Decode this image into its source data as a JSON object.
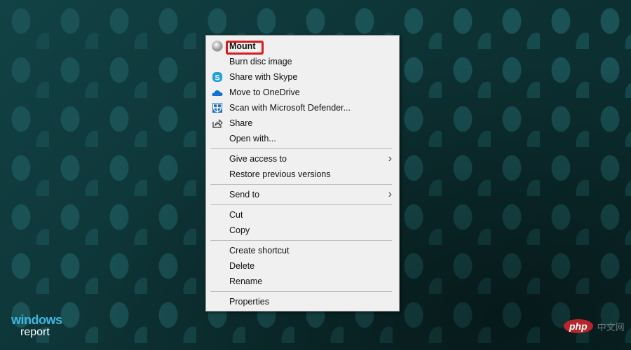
{
  "context_menu": {
    "groups": [
      [
        {
          "label": "Mount",
          "icon": "disc-icon",
          "bold": true,
          "highlighted": true
        },
        {
          "label": "Burn disc image",
          "icon": null
        },
        {
          "label": "Share with Skype",
          "icon": "skype-icon"
        },
        {
          "label": "Move to OneDrive",
          "icon": "onedrive-icon"
        },
        {
          "label": "Scan with Microsoft Defender...",
          "icon": "defender-icon"
        },
        {
          "label": "Share",
          "icon": "share-icon"
        },
        {
          "label": "Open with...",
          "icon": null
        }
      ],
      [
        {
          "label": "Give access to",
          "submenu": true
        },
        {
          "label": "Restore previous versions"
        }
      ],
      [
        {
          "label": "Send to",
          "submenu": true
        }
      ],
      [
        {
          "label": "Cut"
        },
        {
          "label": "Copy"
        }
      ],
      [
        {
          "label": "Create shortcut"
        },
        {
          "label": "Delete"
        },
        {
          "label": "Rename"
        }
      ],
      [
        {
          "label": "Properties"
        }
      ]
    ],
    "highlight_color": "#d21d1d"
  },
  "watermarks": {
    "windows_report": {
      "line1": "windows",
      "line2": "report"
    },
    "php": {
      "badge": "php",
      "text": "中文网"
    }
  }
}
